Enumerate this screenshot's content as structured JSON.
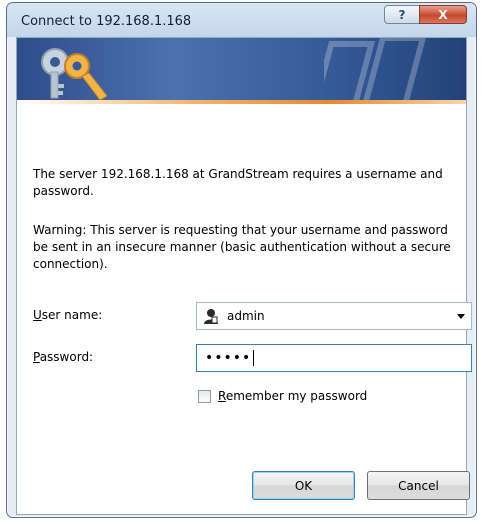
{
  "window": {
    "title": "Connect to 192.168.1.168",
    "help_glyph": "?",
    "close_glyph": "X"
  },
  "banner": {
    "icon": "keys-icon"
  },
  "message": "The server 192.168.1.168 at GrandStream requires a username and password.",
  "warning": "Warning: This server is requesting that your username and password be sent in an insecure manner (basic authentication without a secure connection).",
  "form": {
    "username_label_key": "U",
    "username_label_rest": "ser name:",
    "username_value": "admin",
    "password_label_key": "P",
    "password_label_rest": "assword:",
    "password_mask": "•••••",
    "remember_key": "R",
    "remember_rest": "emember my password",
    "remember_checked": false
  },
  "buttons": {
    "ok": "OK",
    "cancel": "Cancel"
  },
  "colors": {
    "banner": "#2e4d8a",
    "accent": "#e78a2e",
    "close": "#c5482e"
  }
}
